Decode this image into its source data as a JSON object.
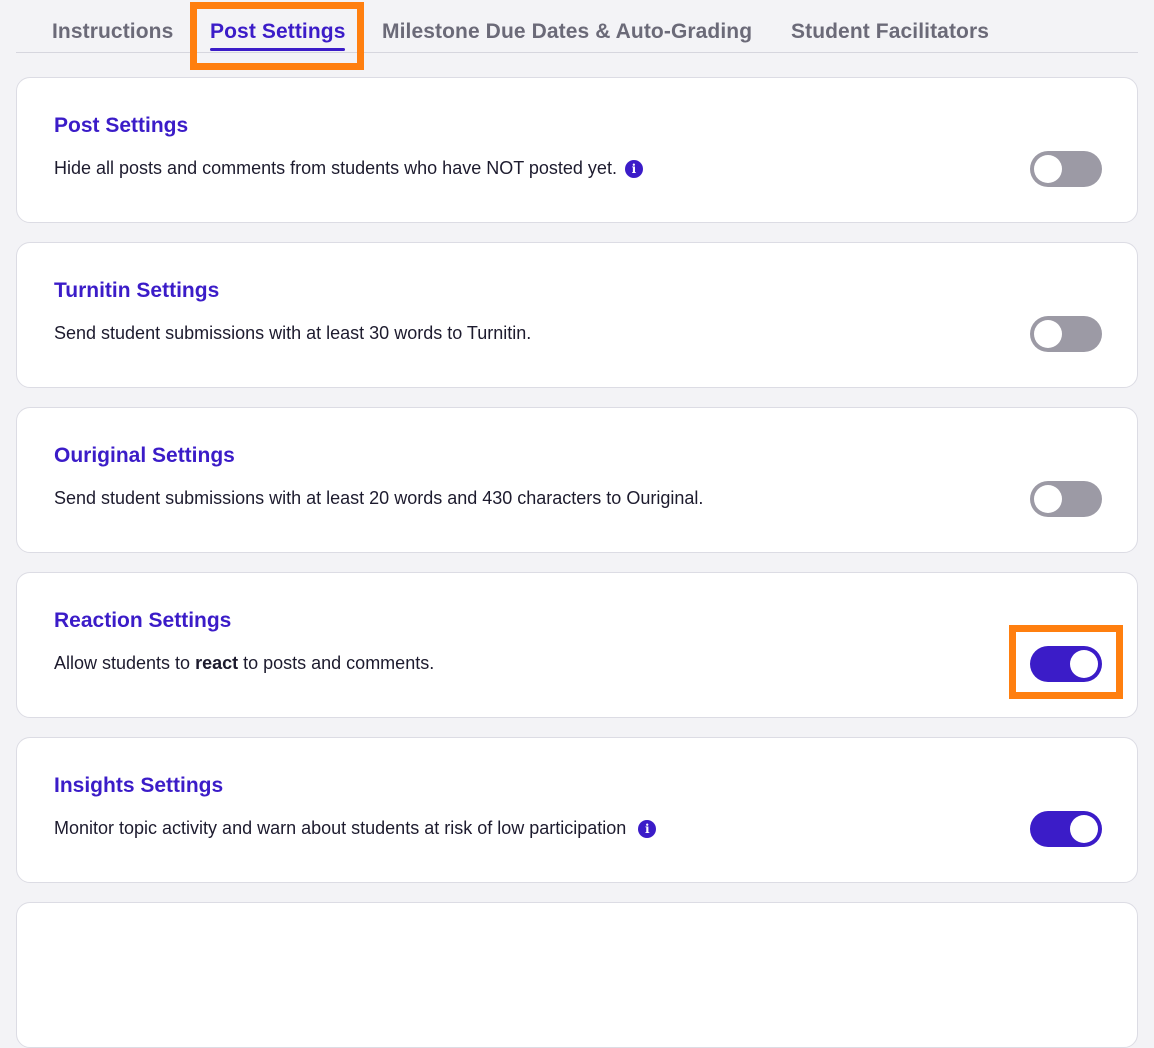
{
  "tabs": [
    {
      "label": "Instructions",
      "active": false
    },
    {
      "label": "Post Settings",
      "active": true
    },
    {
      "label": "Milestone Due Dates & Auto-Grading",
      "active": false
    },
    {
      "label": "Student Facilitators",
      "active": false
    }
  ],
  "cards": [
    {
      "title": "Post Settings",
      "description": "Hide all posts and comments from students who have NOT posted yet.",
      "info_icon": "i",
      "toggle_on": false
    },
    {
      "title": "Turnitin Settings",
      "description": "Send student submissions with at least 30 words to Turnitin.",
      "toggle_on": false
    },
    {
      "title": "Ouriginal Settings",
      "description": "Send student submissions with at least 20 words and 430 characters to Ouriginal.",
      "toggle_on": false
    },
    {
      "title": "Reaction Settings",
      "description_parts": {
        "before": "Allow students to ",
        "bold": "react",
        "after": " to posts and comments."
      },
      "toggle_on": true
    },
    {
      "title": "Insights Settings",
      "description": "Monitor topic activity and warn about students at risk of low participation",
      "info_icon": "i",
      "toggle_on": true
    }
  ],
  "colors": {
    "accent": "#3b1cc8",
    "highlight": "#ff7f0f",
    "toggle_off": "#9c9aa5"
  }
}
